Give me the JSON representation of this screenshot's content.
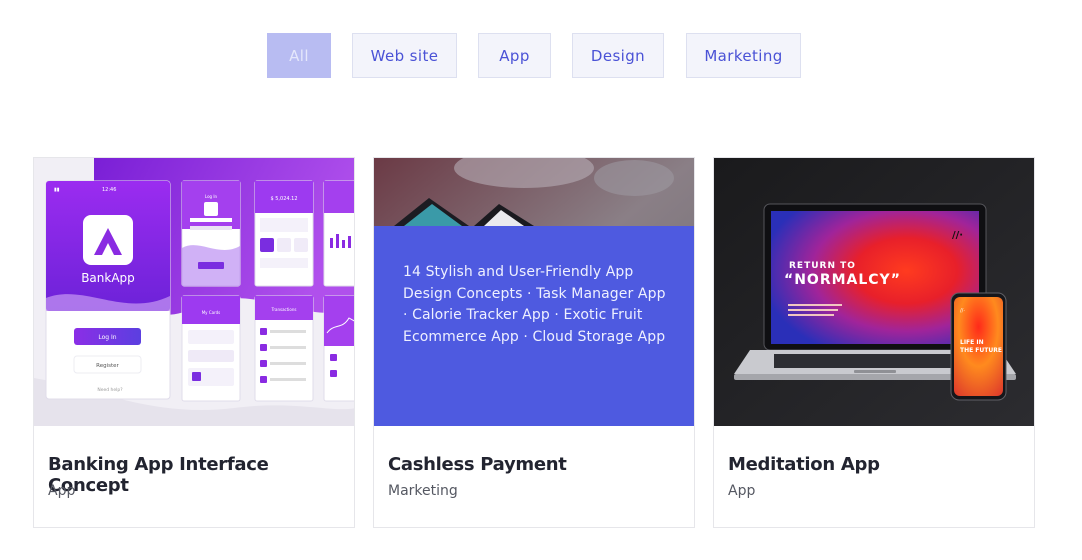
{
  "filters": [
    {
      "label": "All",
      "active": true
    },
    {
      "label": "Web site",
      "active": false
    },
    {
      "label": "App",
      "active": false
    },
    {
      "label": "Design",
      "active": false
    },
    {
      "label": "Marketing",
      "active": false
    }
  ],
  "cards": [
    {
      "title": "Banking App Interface Concept",
      "category": "App",
      "image": {
        "app_name": "BankApp",
        "status_time": "12:46",
        "login_label": "Log In",
        "register_label": "Register",
        "help_text": "Need help?",
        "log_in_title": "Log In",
        "balance": "$ 5,024.12",
        "cards_title": "My Cards",
        "transactions_title": "Transactions"
      }
    },
    {
      "title": "Cashless Payment",
      "category": "Marketing",
      "overlay_text": "14 Stylish and User-Friendly App Design Concepts · Task Manager App · Calorie Tracker App · Exotic Fruit Ecommerce App · Cloud Storage App"
    },
    {
      "title": "Meditation App",
      "category": "App",
      "image": {
        "screen_heading_1": "RETURN TO",
        "screen_heading_2": "“NORMALCY”",
        "phone_text": "LIFE IN THE FUTURE"
      }
    }
  ],
  "colors": {
    "accent": "#4a52d6",
    "active_filter_bg": "#b8bcf2",
    "overlay_bg": "#4e5ae0",
    "bank_purple": "#8a2be2"
  }
}
